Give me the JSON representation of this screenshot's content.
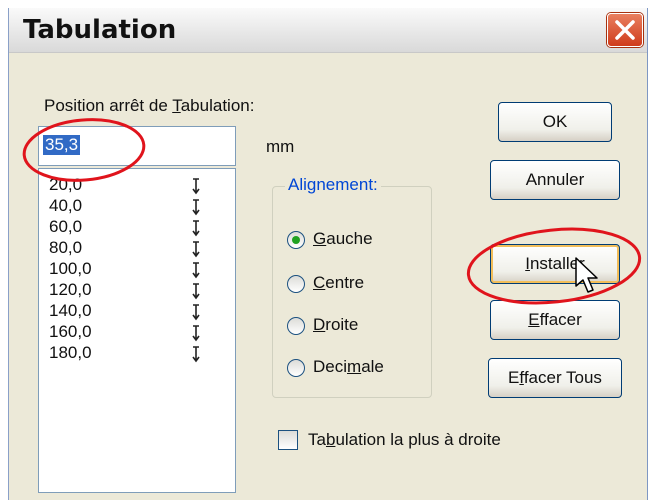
{
  "window": {
    "title": "Tabulation"
  },
  "position_label": {
    "before": "Position arrêt de ",
    "mnemonic": "T",
    "after": "abulation:"
  },
  "position_input": {
    "value": "35,3"
  },
  "unit_label": "mm",
  "tab_stops": [
    "20,0",
    "40,0",
    "60,0",
    "80,0",
    "100,0",
    "120,0",
    "140,0",
    "160,0",
    "180,0"
  ],
  "alignment": {
    "title": "Alignement:",
    "options": [
      {
        "mnemonic": "G",
        "rest": "auche",
        "checked": true
      },
      {
        "mnemonic": "C",
        "rest": "entre",
        "checked": false
      },
      {
        "mnemonic": "D",
        "rest": "roite",
        "checked": false
      },
      {
        "before": "Deci",
        "mnemonic": "m",
        "rest": "ale",
        "checked": false
      }
    ]
  },
  "buttons": {
    "ok": "OK",
    "cancel": "Annuler",
    "install": {
      "mnemonic": "I",
      "rest": "nstaller"
    },
    "clear": {
      "mnemonic": "E",
      "rest": "ffacer"
    },
    "clear_all": {
      "before": "E",
      "mnemonic": "f",
      "rest": "facer Tous"
    }
  },
  "rightmost_checkbox": {
    "before": "Ta",
    "mnemonic": "b",
    "after": "ulation la plus à droite",
    "checked": false
  },
  "colors": {
    "annotation": "#e0141c",
    "selection": "#316ac5",
    "group_title": "#0046d5"
  }
}
